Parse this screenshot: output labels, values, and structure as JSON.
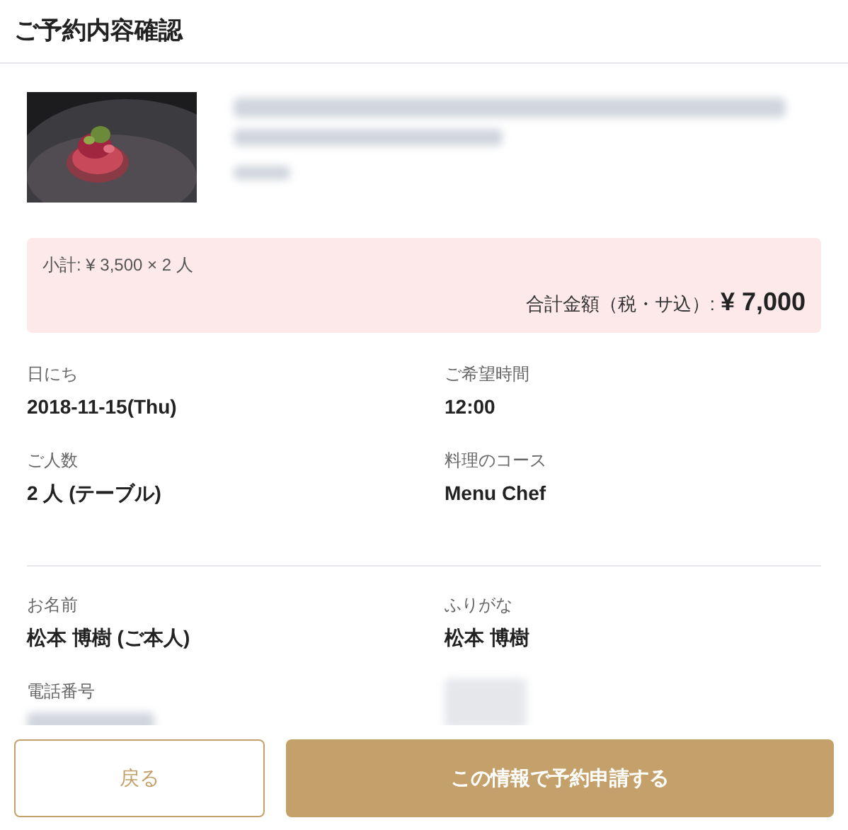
{
  "header": {
    "title": "ご予約内容確認"
  },
  "price": {
    "subtotal": "小計: ¥ 3,500 × 2 人",
    "total_label": "合計金額（税・サ込）:",
    "total": "¥ 7,000"
  },
  "details": [
    {
      "label": "日にち",
      "value": "2018-11-15(Thu)"
    },
    {
      "label": "ご希望時間",
      "value": "12:00"
    },
    {
      "label": "ご人数",
      "value": "2 人 (テーブル)"
    },
    {
      "label": "料理のコース",
      "value": "Menu Chef"
    }
  ],
  "guest": [
    {
      "label": "お名前",
      "value": "松本 博樹 (ご本人)"
    },
    {
      "label": "ふりがな",
      "value": "松本 博樹"
    },
    {
      "label": "電話番号"
    }
  ],
  "buttons": {
    "back": "戻る",
    "submit": "この情報で予約申請する"
  }
}
